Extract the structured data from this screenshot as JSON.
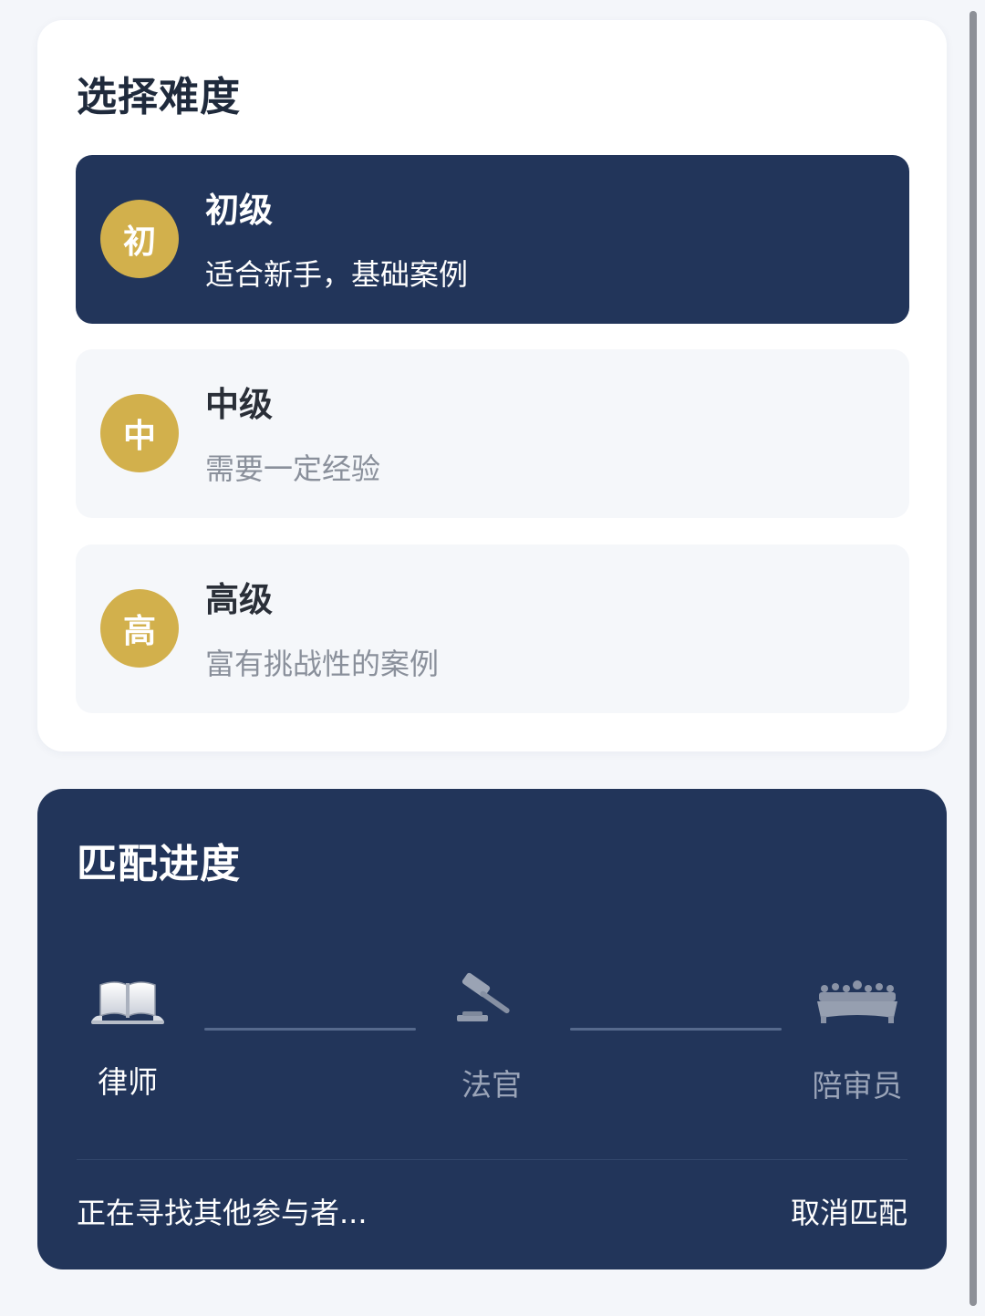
{
  "difficulty": {
    "title": "选择难度",
    "levels": [
      {
        "badge": "初",
        "name": "初级",
        "desc": "适合新手，基础案例",
        "selected": true
      },
      {
        "badge": "中",
        "name": "中级",
        "desc": "需要一定经验",
        "selected": false
      },
      {
        "badge": "高",
        "name": "高级",
        "desc": "富有挑战性的案例",
        "selected": false
      }
    ]
  },
  "progress": {
    "title": "匹配进度",
    "roles": [
      {
        "label": "律师",
        "icon": "book-icon",
        "status": "done"
      },
      {
        "label": "法官",
        "icon": "gavel-icon",
        "status": "pending"
      },
      {
        "label": "陪审员",
        "icon": "jury-icon",
        "status": "pending"
      }
    ],
    "status_text": "正在寻找其他参与者...",
    "cancel_label": "取消匹配"
  },
  "colors": {
    "navy": "#22355a",
    "gold": "#d2b04c",
    "page_bg": "#f4f6fa"
  }
}
